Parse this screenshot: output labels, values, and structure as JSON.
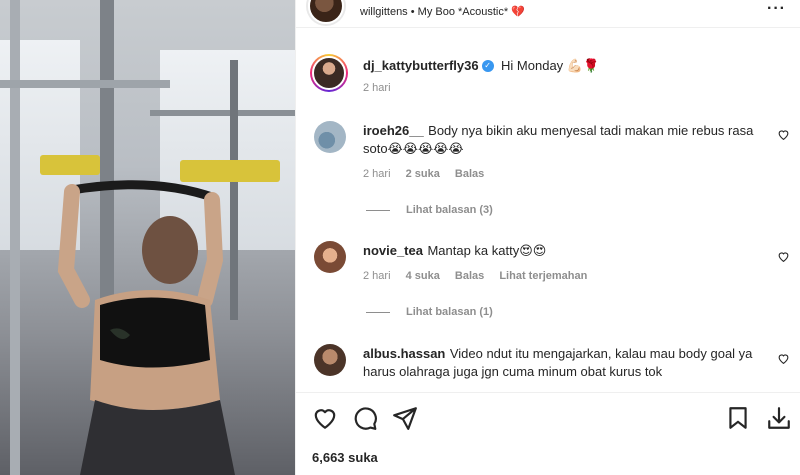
{
  "header": {
    "sub_user": "willgittens",
    "sub_sep": "•",
    "sub_song": "My Boo *Acoustic*",
    "sub_emoji": "💔",
    "more": "···"
  },
  "caption": {
    "username": "dj_kattybutterfly36",
    "verified_mark": "✓",
    "text": "Hi Monday 💪🏻🌹",
    "time": "2 hari"
  },
  "comments": [
    {
      "username": "iroeh26__",
      "text": "Body nya bikin aku menyesal tadi makan mie rebus rasa soto😭😭😭😭😭",
      "time": "2 hari",
      "likes": "2 suka",
      "reply": "Balas",
      "translate": "",
      "view_replies": "Lihat balasan (3)"
    },
    {
      "username": "novie_tea",
      "text": "Mantap ka katty😍😍",
      "time": "2 hari",
      "likes": "4 suka",
      "reply": "Balas",
      "translate": "Lihat terjemahan",
      "view_replies": "Lihat balasan (1)"
    },
    {
      "username": "albus.hassan",
      "text": "Video ndut itu mengajarkan, kalau mau body goal ya harus olahraga juga jgn cuma minum obat kurus tok",
      "time": "",
      "likes": "",
      "reply": "",
      "translate": "",
      "view_replies": ""
    }
  ],
  "actions": {
    "icons": [
      "heart-icon",
      "comment-icon",
      "share-icon",
      "bookmark-icon",
      "download-icon"
    ]
  },
  "likes_count": "6,663 suka",
  "colors": {
    "text": "#262626",
    "muted": "#8e8e8e",
    "verified": "#3897f0",
    "divider": "#efefef"
  }
}
